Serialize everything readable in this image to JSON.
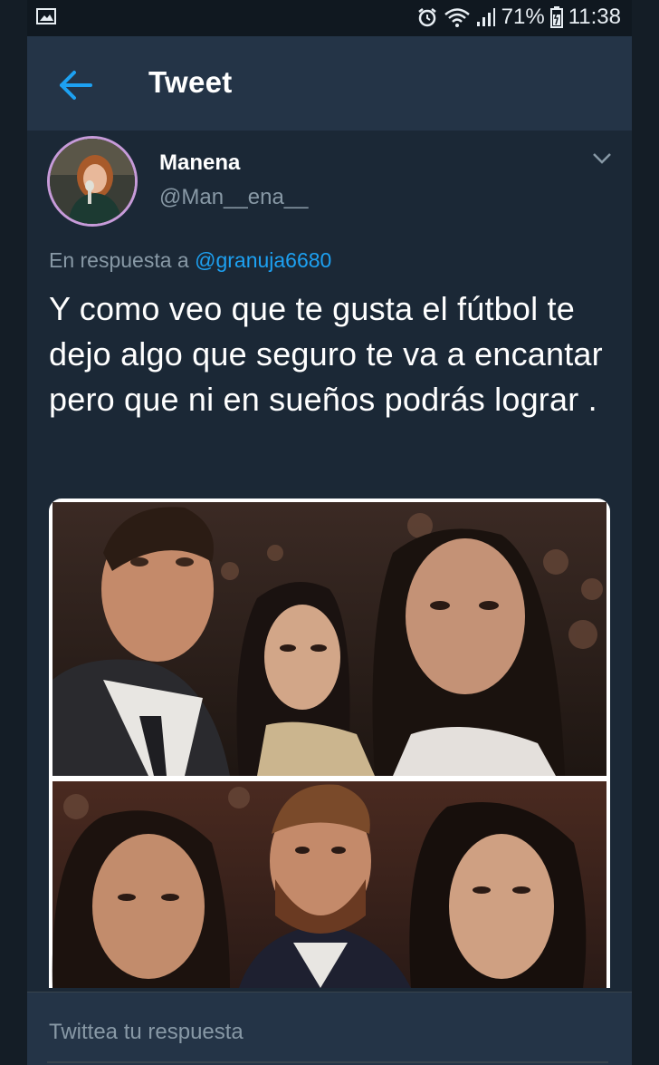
{
  "status_bar": {
    "battery": "71%",
    "time": "11:38",
    "icons": [
      "gallery-icon",
      "alarm-icon",
      "wifi-icon",
      "signal-icon",
      "battery-icon"
    ]
  },
  "header": {
    "title": "Tweet",
    "back_icon": "back-arrow-icon"
  },
  "tweet": {
    "author_name": "Manena",
    "author_handle": "@Man__ena__",
    "reply_prefix": "En respuesta a",
    "reply_mention": "@granuja6680",
    "text": "Y como veo que te gusta el fútbol te dejo algo que seguro te va a encantar pero que ni en sueños podrás lograr .",
    "caret_icon": "chevron-down-icon"
  },
  "reply_bar": {
    "placeholder": "Twittea tu respuesta"
  },
  "colors": {
    "background": "#141d26",
    "header": "#243447",
    "tweet_bg": "#1b2836",
    "link": "#1da1f2",
    "muted": "#8899a6"
  }
}
